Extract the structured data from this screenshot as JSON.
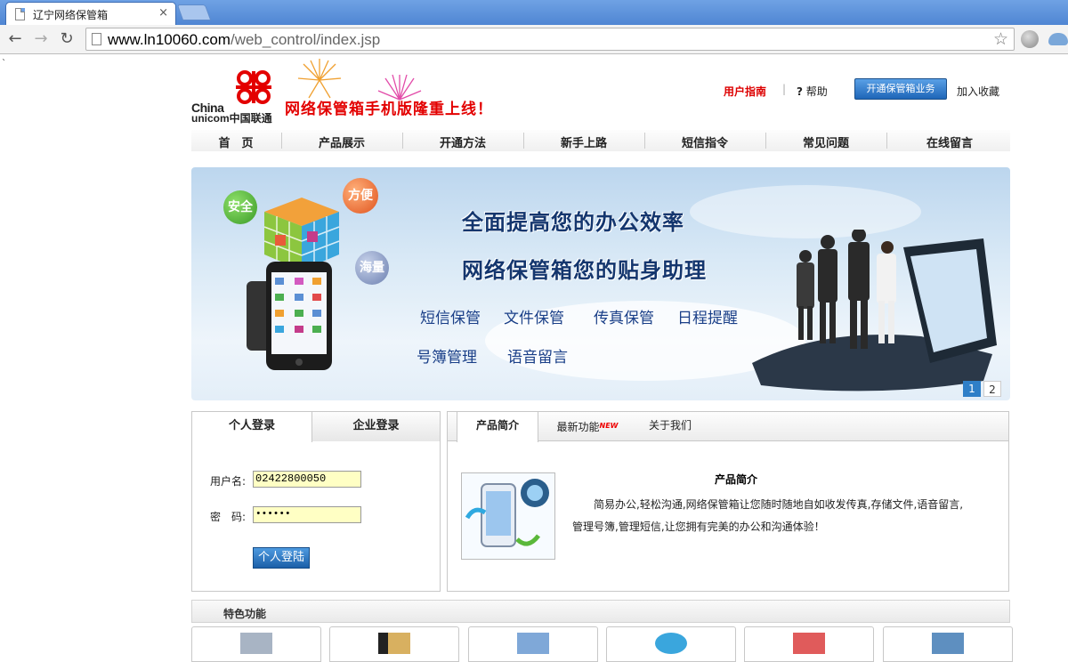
{
  "browser": {
    "tab_title": "辽宁网络保管箱",
    "tab_close": "×",
    "url_domain": "www.ln10060.com",
    "url_path": "/web_control/index.jsp",
    "back": "←",
    "forward": "→",
    "reload": "↻",
    "star": "☆"
  },
  "header": {
    "logo_china": "China",
    "logo_unicom": "unicom中国联通",
    "slogan": "网络保管箱手机版隆重上线！",
    "user_guide": "用户指南",
    "separator": "|",
    "help_mark": "?",
    "help": "帮助",
    "open_service": "开通保管箱业务",
    "add_favorite": "加入收藏"
  },
  "nav": [
    "首　页",
    "产品展示",
    "开通方法",
    "新手上路",
    "短信指令",
    "常见问题",
    "在线留言"
  ],
  "banner": {
    "headline1": "全面提高您的办公效率",
    "headline2": "网络保管箱您的贴身助理",
    "features_row1": [
      "短信保管",
      "文件保管",
      "传真保管",
      "日程提醒"
    ],
    "features_row2": [
      "号簿管理",
      "语音留言"
    ],
    "bubbles": [
      "安全",
      "方便",
      "海量"
    ],
    "pages": [
      "1",
      "2"
    ]
  },
  "login": {
    "tab_personal": "个人登录",
    "tab_enterprise": "企业登录",
    "username_label": "用户名:",
    "username_value": "02422800050",
    "password_label": "密　码:",
    "password_value": "••••••",
    "submit": "个人登陆"
  },
  "info": {
    "tab_intro": "产品简介",
    "tab_new": "最新功能",
    "new_badge": "NEW",
    "tab_about": "关于我们",
    "title": "产品简介",
    "text": "简易办公,轻松沟通,网络保管箱让您随时随地自如收发传真,存储文件,语音留言,管理号簿,管理短信,让您拥有完美的办公和沟通体验！"
  },
  "features": {
    "title": "特色功能"
  },
  "colors": {
    "brand_red": "#e30000",
    "nav_blue": "#1e66b8",
    "banner_text": "#14366e"
  }
}
